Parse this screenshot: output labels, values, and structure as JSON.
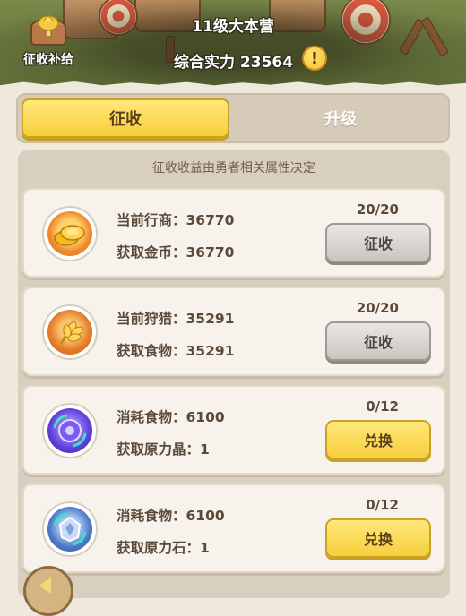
{
  "header": {
    "camp_title": "11级大本营",
    "power_text": "综合实力 23564",
    "info_glyph": "!",
    "supply_label": "征收补给",
    "supply_icon": "chest-icon"
  },
  "tabs": [
    {
      "label": "征收",
      "active": true
    },
    {
      "label": "升级",
      "active": false
    }
  ],
  "panel": {
    "hint": "征收收益由勇者相关属性决定",
    "cards": [
      {
        "icon": "gold-coins-icon",
        "line1": "当前行商：36770",
        "line2": "获取金币：36770",
        "count": "20/20",
        "button": "征收",
        "button_style": "grey"
      },
      {
        "icon": "wheat-food-icon",
        "line1": "当前狩猎：35291",
        "line2": "获取食物：35291",
        "count": "20/20",
        "button": "征收",
        "button_style": "grey"
      },
      {
        "icon": "force-crystal-icon",
        "line1": "消耗食物：6100",
        "line2": "获取原力晶：1",
        "count": "0/12",
        "button": "兑换",
        "button_style": "yellow"
      },
      {
        "icon": "force-stone-icon",
        "line1": "消耗食物：6100",
        "line2": "获取原力石：1",
        "count": "0/12",
        "button": "兑换",
        "button_style": "yellow"
      }
    ]
  },
  "colors": {
    "accent_yellow": "#f7cf3c",
    "panel_bg": "#d9cfbf",
    "card_bg": "#f7f3ec",
    "text_brown": "#5b4a3a"
  }
}
